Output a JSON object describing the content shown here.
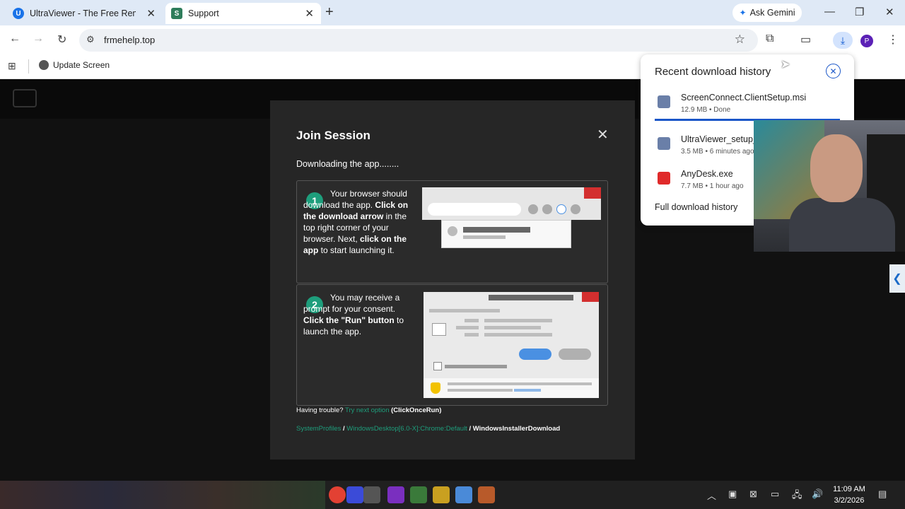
{
  "browser": {
    "tabs": [
      {
        "title": "UltraViewer - The Free Remote",
        "favicon": "ultraviewer-icon",
        "active": false
      },
      {
        "title": "Support",
        "favicon": "screenconnect-icon",
        "active": true
      }
    ],
    "gemini_label": "Ask Gemini",
    "url": "frmehelp.top",
    "profile_initial": "P",
    "bookmarks": [
      {
        "label": "Update Screen"
      }
    ]
  },
  "dialog": {
    "title": "Join Session",
    "status": "Downloading the app........",
    "steps": [
      {
        "number": "1"
      },
      {
        "number": "2"
      }
    ],
    "step1": {
      "t1": "Your browser should download the app. ",
      "b1": "Click on the download arrow",
      "t2": " in the top right corner of your browser. Next, ",
      "b2": "click on the app",
      "t3": " to start launching it."
    },
    "step2": {
      "t1": "You may receive a prompt for your consent. ",
      "b1": "Click the \"Run\" button",
      "t2": " to launch the app."
    },
    "trouble": {
      "prefix": "Having trouble? ",
      "link": "Try next option",
      "suffix": "(ClickOnceRun)"
    },
    "paths": {
      "p1": "SystemProfiles",
      "sep1": " / ",
      "p2": "WindowsDesktop[6.0-X]:Chrome:Default",
      "sep2": " / ",
      "p3": "WindowsInstallerDownload"
    }
  },
  "downloads": {
    "title": "Recent download history",
    "items": [
      {
        "filename": "ScreenConnect.ClientSetup.msi",
        "meta": "12.9 MB • Done",
        "icon": "installer-icon"
      },
      {
        "filename": "UltraViewer_setup_",
        "meta": "3.5 MB • 6 minutes ago",
        "icon": "installer-icon"
      },
      {
        "filename": "AnyDesk.exe",
        "meta": "7.7 MB • 1 hour ago",
        "icon": "anydesk-icon"
      }
    ],
    "full_history": "Full download history"
  },
  "taskbar": {
    "time": "11:09 AM",
    "date": "3/2/2026"
  },
  "colors": {
    "accent_green": "#1e9e7c",
    "chrome_blue": "#1a56c8",
    "dialog_bg": "#262626"
  }
}
